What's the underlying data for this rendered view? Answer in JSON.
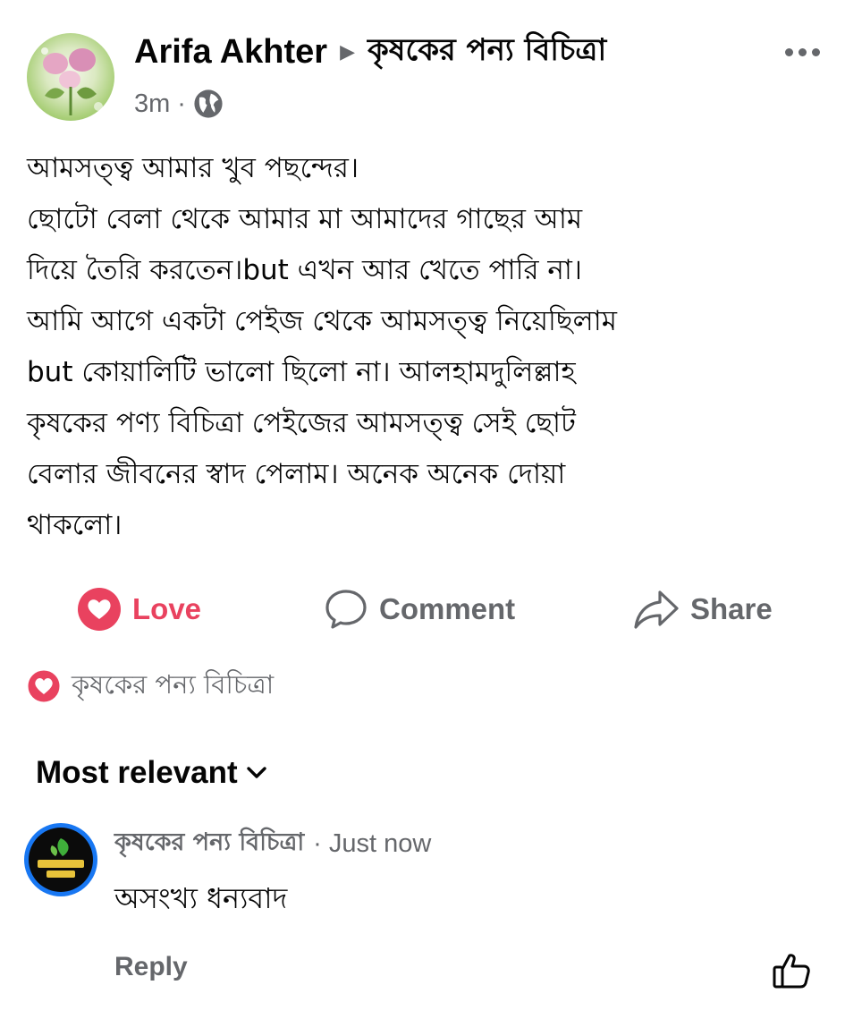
{
  "post": {
    "author": "Arifa Akhter",
    "group": "কৃষকের পন্য বিচিত্রা",
    "time": "3m",
    "separator": "·",
    "audience_icon": "globe-icon",
    "body_lines": [
      "আমসত্ত্ব আমার খুব পছন্দের।",
      "ছোটো বেলা থেকে আমার মা আমাদের গাছের আম",
      "দিয়ে তৈরি করতেন।but এখন আর খেতে পারি না।",
      "আমি আগে একটা পেইজ থেকে আমসত্ত্ব নিয়েছিলাম",
      "but কোয়ালিটি ভালো ছিলো না। আলহামদুলিল্লাহ",
      "কৃষকের পণ্য বিচিত্রা পেইজের আমসত্ত্ব সেই ছোট",
      "বেলার জীবনের স্বাদ পেলাম। অনেক অনেক দোয়া",
      "থাকলো।"
    ]
  },
  "actions": {
    "love_label": "Love",
    "comment_label": "Comment",
    "share_label": "Share"
  },
  "reactions": {
    "summary": "কৃষকের পন্য বিচিত্রা",
    "icon": "love-reaction-icon"
  },
  "comments": {
    "sort_label": "Most relevant",
    "items": [
      {
        "author": "কৃষকের পন্য বিচিত্রা",
        "time": "· Just now",
        "text": "অসংখ্য ধন্যবাদ",
        "reply_label": "Reply"
      }
    ]
  },
  "colors": {
    "love": "#e9425f",
    "secondary_text": "#65676b",
    "primary_text": "#050505",
    "avatar_ring": "#1877f2"
  }
}
